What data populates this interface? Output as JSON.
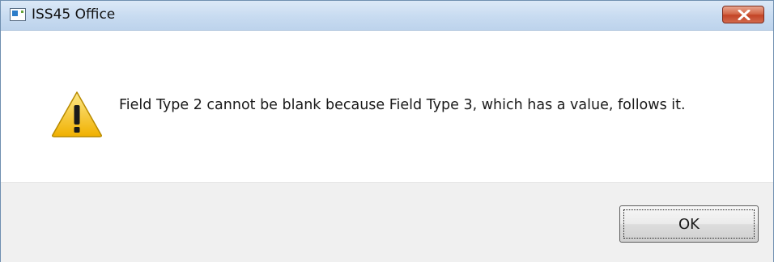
{
  "window": {
    "title": "ISS45 Office",
    "app_icon": "app-window-icon",
    "close_icon": "close-icon"
  },
  "dialog": {
    "icon": "warning-icon",
    "message": "Field Type 2 cannot be blank because Field Type 3, which has a value, follows it.",
    "ok_label": "OK"
  },
  "colors": {
    "close_button": "#c84a2c",
    "warning_fill": "#f5c518",
    "button_area_bg": "#f0f0f0"
  }
}
